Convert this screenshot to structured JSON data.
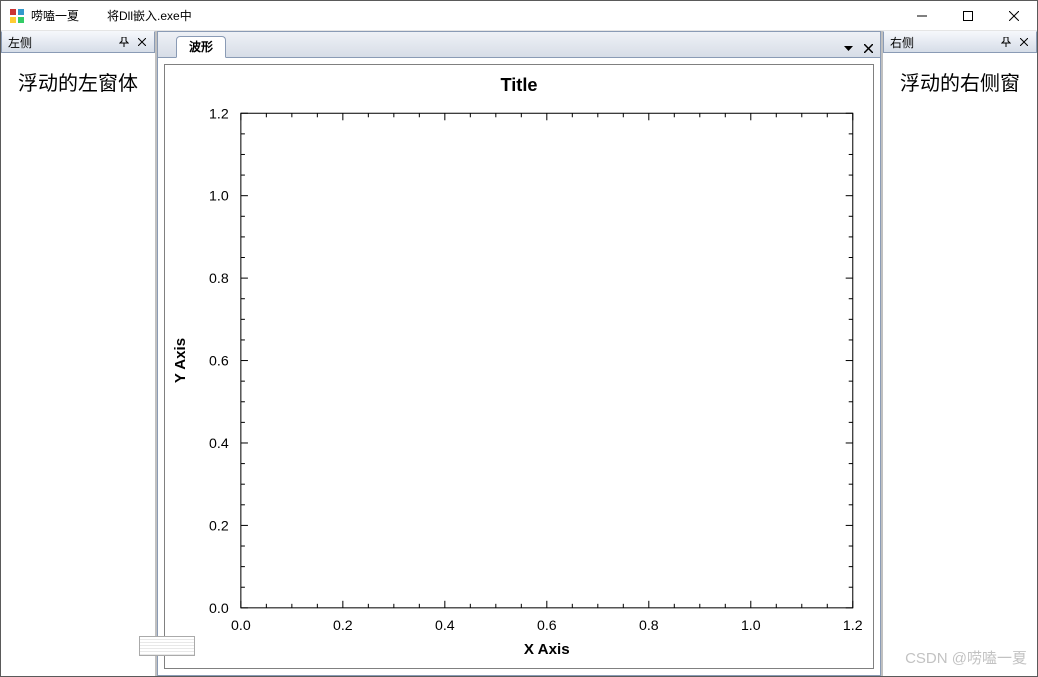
{
  "window": {
    "caption1": "唠嗑一夏",
    "caption2": "将Dll嵌入.exe中"
  },
  "left_panel": {
    "title": "左侧",
    "body": "浮动的左窗体"
  },
  "right_panel": {
    "title": "右侧",
    "body": "浮动的右侧窗"
  },
  "tabs": {
    "active": "波形"
  },
  "watermark": "CSDN @唠嗑一夏",
  "chart_data": {
    "type": "scatter",
    "title": "Title",
    "xlabel": "X Axis",
    "ylabel": "Y Axis",
    "xlim": [
      0.0,
      1.2
    ],
    "ylim": [
      0.0,
      1.2
    ],
    "x_ticks": [
      0.0,
      0.2,
      0.4,
      0.6,
      0.8,
      1.0,
      1.2
    ],
    "y_ticks": [
      0.0,
      0.2,
      0.4,
      0.6,
      0.8,
      1.0,
      1.2
    ],
    "series": [
      {
        "name": "",
        "x": [],
        "y": []
      }
    ]
  }
}
